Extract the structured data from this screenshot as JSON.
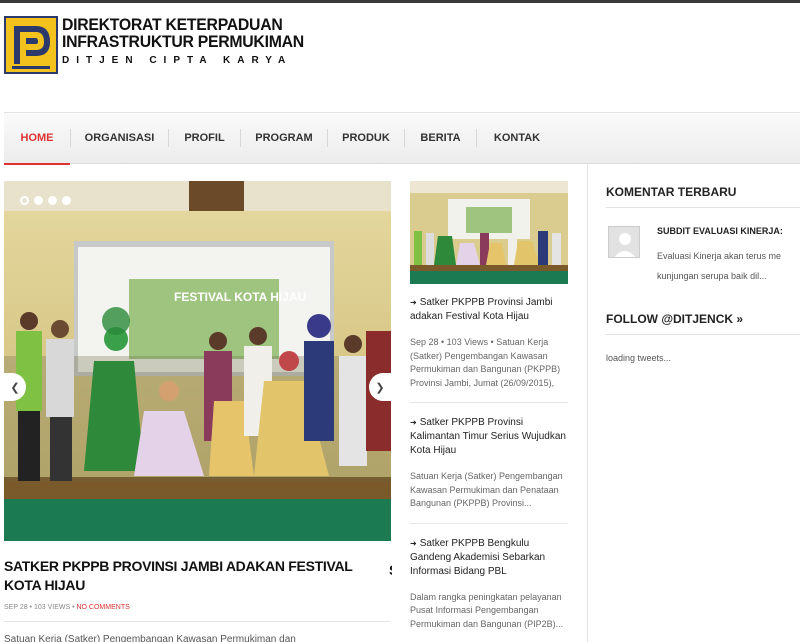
{
  "header": {
    "logo_line1": "DIREKTORAT KETERPADUAN",
    "logo_line2": "INFRASTRUKTUR PERMUKIMAN",
    "logo_line3": "DITJEN CIPTA KARYA"
  },
  "nav": {
    "items": [
      {
        "label": "HOME"
      },
      {
        "label": "ORGANISASI"
      },
      {
        "label": "PROFIL"
      },
      {
        "label": "PROGRAM"
      },
      {
        "label": "PRODUK"
      },
      {
        "label": "BERITA"
      },
      {
        "label": "KONTAK"
      }
    ],
    "active_index": 0
  },
  "slider": {
    "dots_count": 4,
    "active_dot": 0,
    "banner_text": "FESTIVAL KOTA HIJAU"
  },
  "featured": {
    "title": "SATKER PKPPB PROVINSI JAMBI ADAKAN FESTIVAL KOTA HIJAU",
    "meta_date_views": "SEP 28 • 103 VIEWS •",
    "meta_comments": "NO COMMENTS",
    "excerpt": "Satuan Kerja (Satker) Pengembangan Kawasan Permukiman dan"
  },
  "posts": [
    {
      "title": "Satker PKPPB Provinsi Jambi adakan Festival Kota Hijau",
      "meta": "Sep 28 • 103 Views • Satuan Kerja (Satker) Pengembangan Kawasan Permukiman dan Bangunan (PKPPB) Provinsi Jambi, Jumat (26/09/2015),"
    },
    {
      "title": "Satker PKPPB Provinsi Kalimantan Timur Serius Wujudkan Kota Hijau",
      "excerpt": "Satuan Kerja (Satker) Pengembangan Kawasan Permukiman dan Penataan Bangunan (PKPPB) Provinsi..."
    },
    {
      "title": "Satker PKPPB Bengkulu Gandeng Akademisi Sebarkan Informasi Bidang PBL",
      "excerpt": "Dalam rangka peningkatan pelayanan Pusat Informasi Pengembangan Permukiman dan Bangunan (PIP2B)..."
    }
  ],
  "sidebar": {
    "comments_title": "KOMENTAR TERBARU",
    "comment_author": "SUBDIT EVALUASI KINERJA:",
    "comment_text_1": "Evaluasi Kinerja akan terus me",
    "comment_text_2": "kunjungan serupa baik dil...",
    "follow_title": "FOLLOW @DITJENCK »",
    "loading": "loading tweets..."
  },
  "colors": {
    "accent_red": "#dd3333",
    "logo_yellow": "#f4c21d",
    "logo_navy": "#2b3a6a"
  }
}
